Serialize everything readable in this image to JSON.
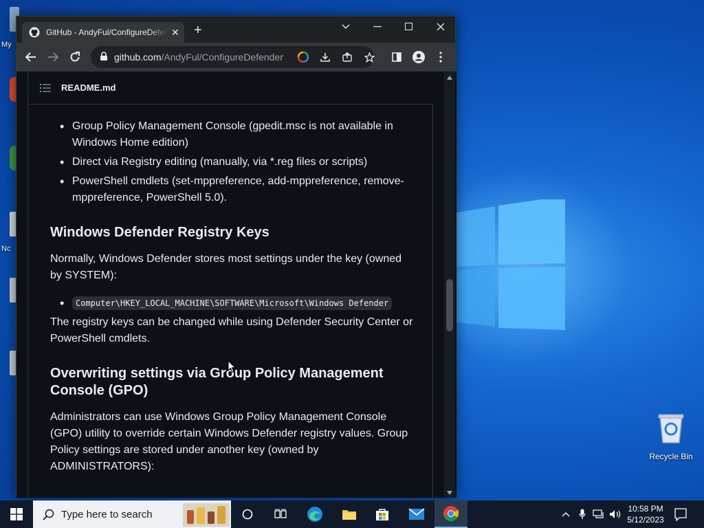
{
  "desktop": {
    "recycle_bin_label": "Recycle Bin",
    "left_icon_labels": [
      "My",
      "Nc"
    ]
  },
  "browser": {
    "tab_title": "GitHub - AndyFul/ConfigureDefender",
    "tab_close": "✕",
    "new_tab": "+",
    "url_host": "github.com",
    "url_path": "/AndyFul/ConfigureDefender"
  },
  "readme": {
    "title": "README.md",
    "bullets_top": [
      "Group Policy Management Console (gpedit.msc is not available in Windows Home edition)",
      "Direct via Registry editing (manually, via *.reg files or scripts)",
      "PowerShell cmdlets (set-mppreference, add-mppreference, remove-mppreference, PowerShell 5.0)."
    ],
    "heading1": "Windows Defender Registry Keys",
    "para1": "Normally, Windows Defender stores most settings under the key (owned by SYSTEM):",
    "code1": "Computer\\HKEY_LOCAL_MACHINE\\SOFTWARE\\Microsoft\\Windows Defender",
    "para2": "The registry keys can be changed while using Defender Security Center or PowerShell cmdlets.",
    "heading2": "Overwriting settings via Group Policy Management Console (GPO)",
    "para3": "Administrators can use Windows Group Policy Management Console (GPO) utility to override certain Windows Defender registry values. Group Policy settings are stored under another key (owned by ADMINISTRATORS):"
  },
  "taskbar": {
    "search_placeholder": "Type here to search",
    "time": "10:58 PM",
    "date": "5/12/2023"
  },
  "colors": {
    "page_bg": "#0d1117",
    "text": "#e6edf3",
    "taskbar": "#101a2b",
    "accent": "#76b9ed"
  }
}
